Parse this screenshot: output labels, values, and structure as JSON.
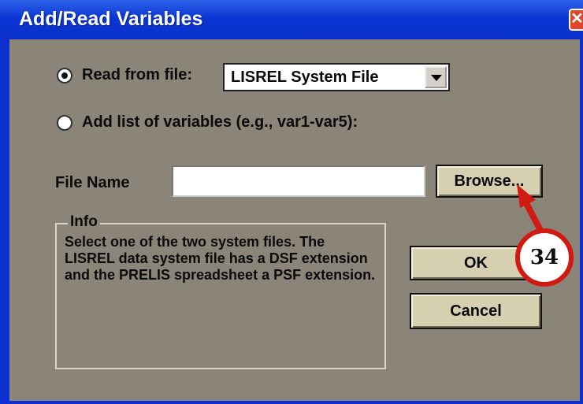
{
  "window": {
    "title": "Add/Read Variables",
    "close_label": "✕"
  },
  "options": {
    "read_from_file_label": "Read from file:",
    "read_from_file_checked": true,
    "file_type_selected": "LISREL System File",
    "add_list_label": "Add list of variables (e.g., var1-var5):",
    "add_list_checked": false
  },
  "file": {
    "label": "File Name",
    "value": "",
    "browse_label": "Browse..."
  },
  "info": {
    "legend": "Info",
    "text": "Select one of the two system files. The LISREL data system file has a DSF extension and the PRELIS spreadsheet a PSF extension."
  },
  "buttons": {
    "ok_label": "OK",
    "cancel_label": "Cancel"
  },
  "annotation": {
    "step_number": "34",
    "color": "#d11a12"
  }
}
